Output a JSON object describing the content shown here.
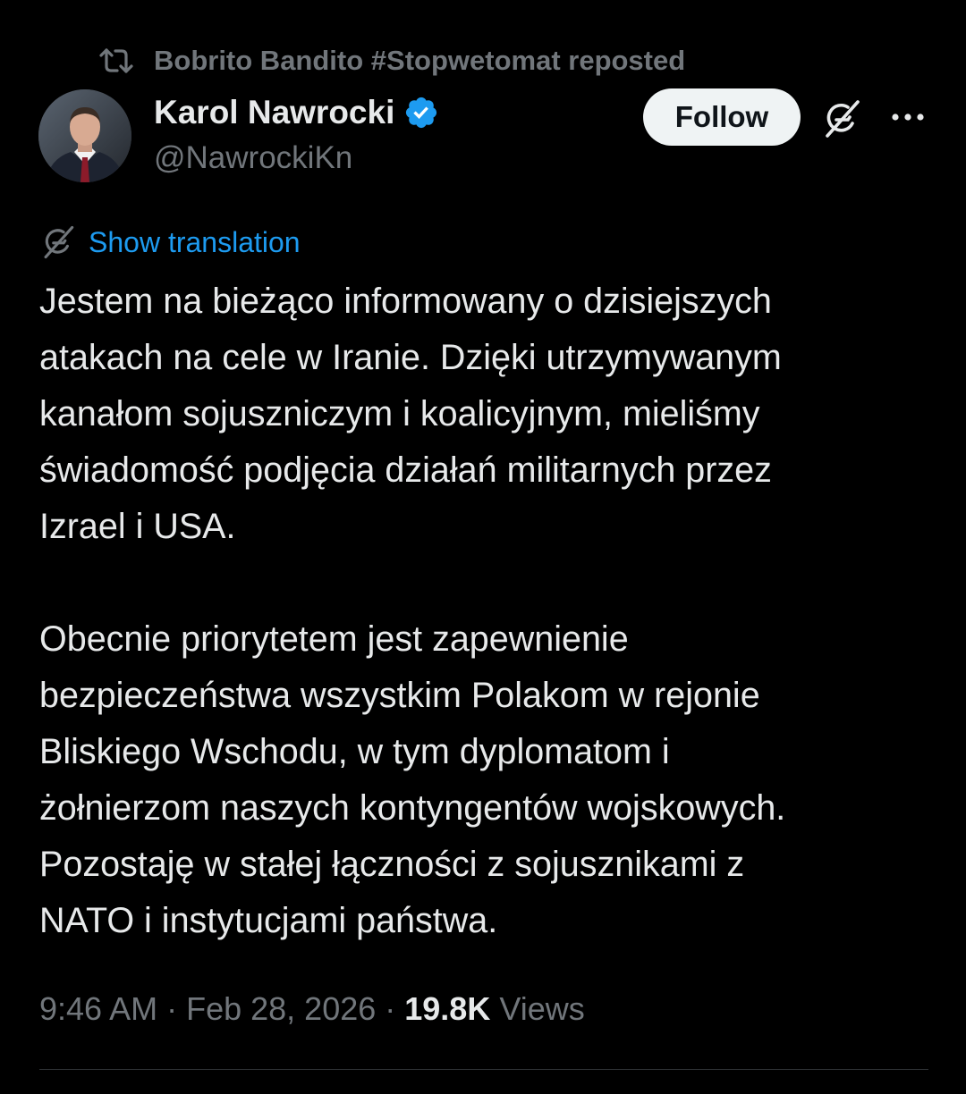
{
  "repost": {
    "text": "Bobrito Bandito #Stopwetomat reposted",
    "icon": "repost-icon"
  },
  "author": {
    "name": "Karol Nawrocki",
    "handle": "@NawrockiKn",
    "verified": true,
    "verified_color": "#1d9bf0"
  },
  "actions": {
    "follow_label": "Follow",
    "grok_icon": "grok-icon",
    "more_icon": "more-icon"
  },
  "translation": {
    "label": "Show translation",
    "icon": "grok-icon",
    "color": "#1d9bf0"
  },
  "tweet": {
    "paragraph1": "Jestem na bieżąco informowany o dzisiejszych\natakach na cele w Iranie. Dzięki utrzymywanym\nkanałom sojuszniczym i koalicyjnym, mieliśmy\nświadomość podjęcia działań militarnych przez\nIzrael i USA.",
    "paragraph2": "Obecnie priorytetem jest zapewnienie\nbezpieczeństwa wszystkim Polakom w rejonie\nBliskiego Wschodu, w tym dyplomatom i\nżołnierzom naszych kontyngentów wojskowych.\nPozostaję w stałej łączności z sojusznikami z\nNATO i instytucjami państwa."
  },
  "meta": {
    "time": "9:46 AM",
    "separator": " · ",
    "date": "Feb 28, 2026",
    "views_count": "19.8K",
    "views_label": "Views"
  },
  "colors": {
    "background": "#000000",
    "text_primary": "#e7e9ea",
    "text_secondary": "#71767b",
    "link": "#1d9bf0",
    "follow_bg": "#eff3f4",
    "divider": "#2f3336"
  }
}
